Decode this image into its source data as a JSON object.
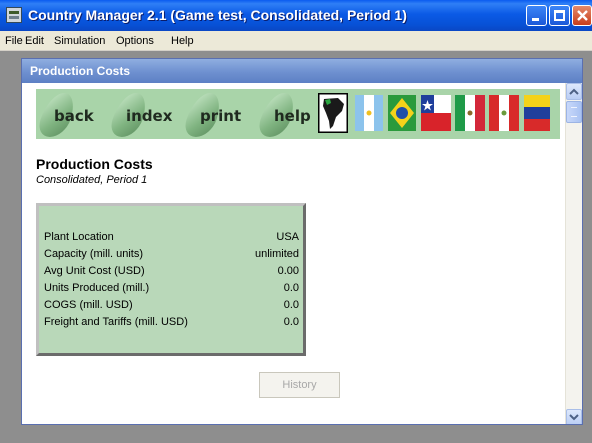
{
  "window": {
    "title": "Country Manager 2.1 (Game test, Consolidated, Period 1)"
  },
  "menu": [
    {
      "label": "File"
    },
    {
      "label": "Edit"
    },
    {
      "label": "Simulation"
    },
    {
      "label": "Options"
    },
    {
      "label": "Help"
    }
  ],
  "panel": {
    "title": "Production Costs"
  },
  "nav": {
    "buttons": [
      {
        "label": "back"
      },
      {
        "label": "index"
      },
      {
        "label": "print"
      },
      {
        "label": "help"
      }
    ],
    "flags": [
      "map-icon",
      "argentina-flag-icon",
      "brazil-flag-icon",
      "chile-flag-icon",
      "mexico-flag-icon",
      "peru-flag-icon",
      "venezuela-flag-icon"
    ]
  },
  "content": {
    "title": "Production Costs",
    "subtitle": "Consolidated, Period 1",
    "rows": [
      {
        "label": "Plant Location",
        "value": "USA"
      },
      {
        "label": "Capacity (mill. units)",
        "value": "unlimited"
      },
      {
        "label": "Avg Unit Cost (USD)",
        "value": "0.00"
      },
      {
        "label": "Units Produced (mill.)",
        "value": "0.0"
      },
      {
        "label": "COGS (mill. USD)",
        "value": "0.0"
      },
      {
        "label": "Freight and Tariffs (mill. USD)",
        "value": "0.0"
      }
    ],
    "history_label": "History"
  },
  "colors": {
    "card_bg": "#b9d8b9",
    "nav_bg": "#a9d4a9",
    "titlebar": "#0a5bf0"
  }
}
